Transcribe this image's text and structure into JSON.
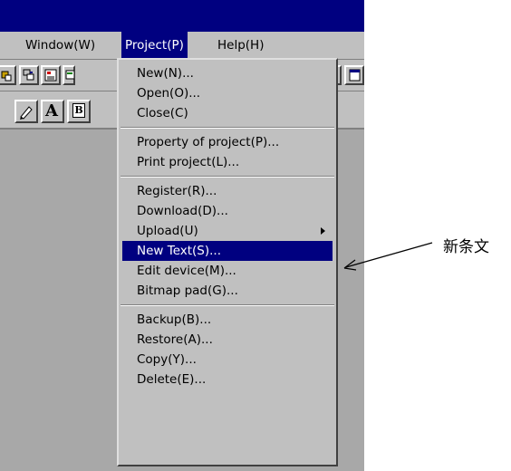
{
  "menubar": {
    "items": [
      "Window(W)",
      "Project(P)",
      "Help(H)"
    ],
    "active_index": 1
  },
  "project_menu": {
    "groups": [
      [
        "New(N)...",
        "Open(O)...",
        "Close(C)"
      ],
      [
        "Property of project(P)...",
        "Print project(L)..."
      ],
      [
        "Register(R)...",
        "Download(D)...",
        "Upload(U)",
        "New Text(S)...",
        "Edit device(M)...",
        "Bitmap pad(G)..."
      ],
      [
        "Backup(B)...",
        "Restore(A)...",
        "Copy(Y)...",
        "Delete(E)..."
      ]
    ],
    "highlighted": "New Text(S)...",
    "has_submenu": "Upload(U)"
  },
  "toolbar2": {
    "text_button": "A",
    "bold_button": "B"
  },
  "annotation": {
    "label": "新条文"
  },
  "colors": {
    "title_bar": "#000080",
    "menu_bg": "#c0c0c0",
    "highlight": "#000080",
    "workspace": "#a8a8a8"
  },
  "icons": [
    "connect-icon",
    "disconnect-icon",
    "document-icon",
    "device-icon",
    "pen-icon",
    "text-icon",
    "bold-text-icon"
  ]
}
